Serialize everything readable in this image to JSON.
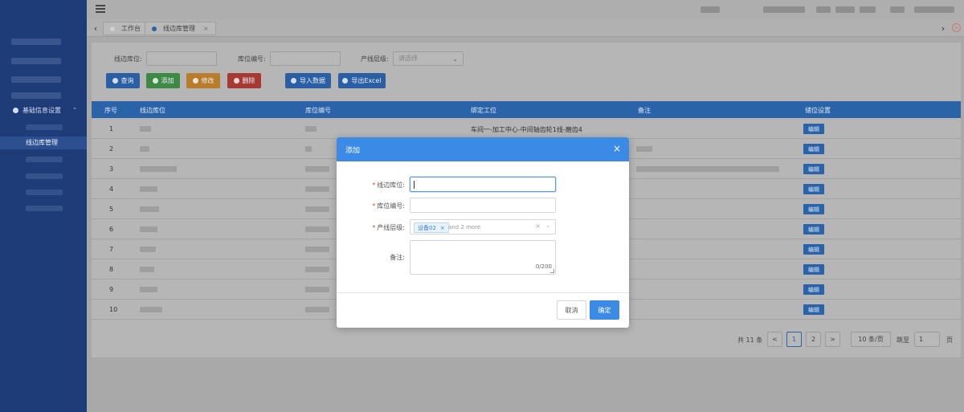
{
  "sidebar": {
    "group_label": "基础信息设置",
    "active_item": "线边库管理"
  },
  "tabs": [
    {
      "label": "工作台"
    },
    {
      "label": "线边库管理"
    }
  ],
  "filters": {
    "field1_label": "线边库位:",
    "field2_label": "库位编号:",
    "field3_label": "产线层级:",
    "field3_placeholder": "请选择"
  },
  "toolbar": {
    "query": "查询",
    "add": "添加",
    "edit": "修改",
    "delete": "删除",
    "import": "导入数据",
    "export": "导出Excel",
    "colors": {
      "query": "#2a5fa3",
      "add": "#3e8a44",
      "edit": "#b97c2b",
      "delete": "#a63a33",
      "import": "#2a5fa3",
      "export": "#2a5fa3"
    }
  },
  "table": {
    "headers": [
      "序号",
      "线边库位",
      "库位编号",
      "绑定工位",
      "备注",
      "储位设置"
    ],
    "rows": [
      {
        "no": "1",
        "station": "车间一-加工中心-中间轴齿轮1线-磨齿4",
        "edit": "编辑"
      },
      {
        "no": "2",
        "station": "",
        "edit": "编辑"
      },
      {
        "no": "3",
        "station": "",
        "edit": "编辑"
      },
      {
        "no": "4",
        "station": "",
        "edit": "编辑"
      },
      {
        "no": "5",
        "station": "",
        "edit": "编辑"
      },
      {
        "no": "6",
        "station": "",
        "edit": "编辑"
      },
      {
        "no": "7",
        "station": "",
        "edit": "编辑"
      },
      {
        "no": "8",
        "station": "",
        "edit": "编辑"
      },
      {
        "no": "9",
        "station": "",
        "edit": "编辑"
      },
      {
        "no": "10",
        "station": "",
        "edit": "编辑"
      }
    ]
  },
  "pagination": {
    "total": "共 11 条",
    "prev": "<",
    "page1": "1",
    "page2": "2",
    "next": ">",
    "page_size": "10 条/页",
    "goto_label": "跳至",
    "goto_value": "1",
    "page_suffix": "页"
  },
  "modal": {
    "title": "添加",
    "close": "×",
    "field1_label": "线边库位:",
    "field2_label": "库位编号:",
    "field3_label": "产线层级:",
    "field3_tag": "设备02",
    "field3_more": "and 2 more",
    "field4_label": "备注:",
    "counter": "0/200",
    "cancel": "取消",
    "ok": "确定"
  }
}
